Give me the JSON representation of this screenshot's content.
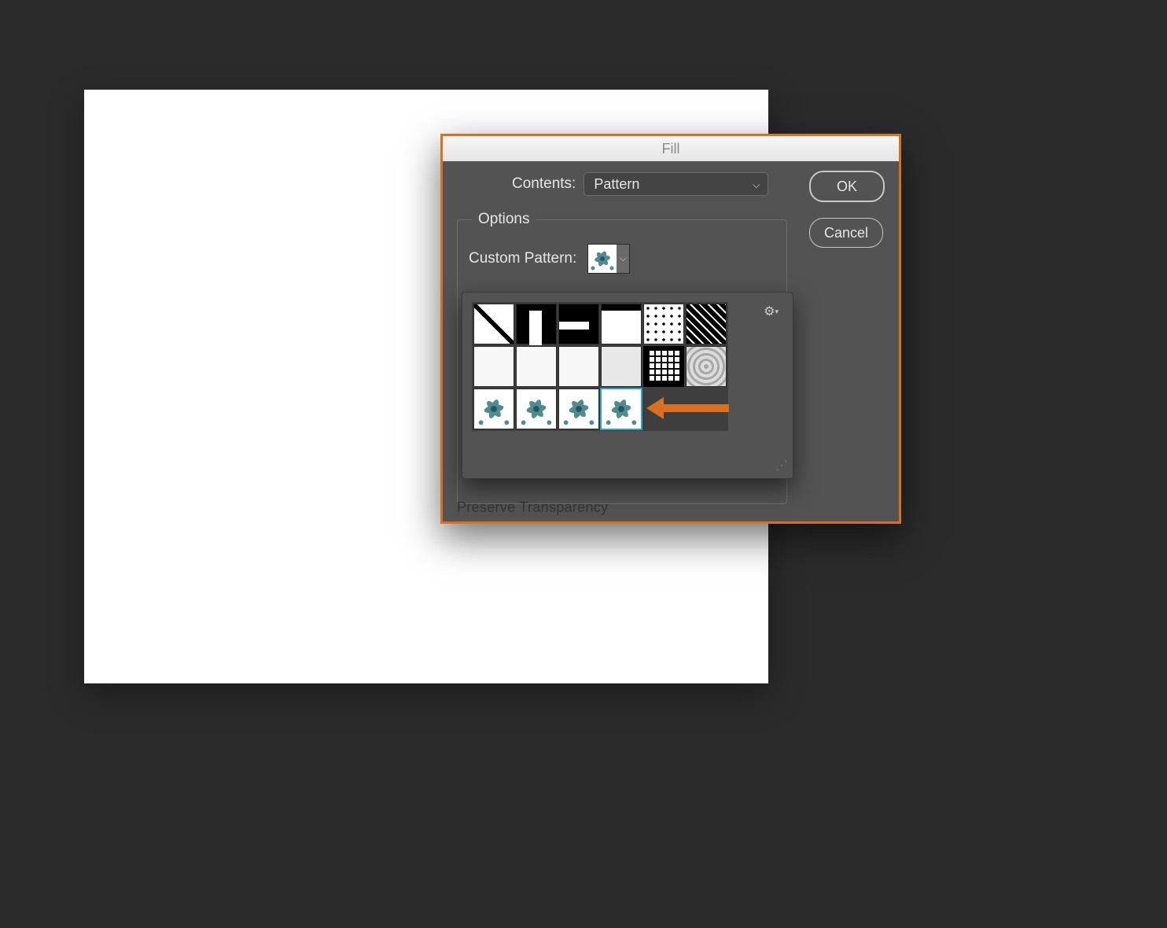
{
  "dialog": {
    "title": "Fill",
    "contents_label": "Contents:",
    "contents_value": "Pattern",
    "ok_label": "OK",
    "cancel_label": "Cancel",
    "options_label": "Options",
    "custom_pattern_label": "Custom Pattern:",
    "preserve_transparency_label": "Preserve Transparency"
  },
  "picker": {
    "gear_icon": "gear-icon",
    "selected_index": 15,
    "patterns": [
      {
        "name": "diagonal-line"
      },
      {
        "name": "vertical-bar"
      },
      {
        "name": "horizontal-bar"
      },
      {
        "name": "top-stripe"
      },
      {
        "name": "polka-dots"
      },
      {
        "name": "pixel-diagonal"
      },
      {
        "name": "noise-light-1"
      },
      {
        "name": "noise-light-2"
      },
      {
        "name": "noise-light-3"
      },
      {
        "name": "noise-gray"
      },
      {
        "name": "concentric-squares"
      },
      {
        "name": "gray-ripple"
      },
      {
        "name": "teal-flower-1"
      },
      {
        "name": "teal-flower-2"
      },
      {
        "name": "teal-flower-3"
      },
      {
        "name": "teal-flower-4"
      }
    ]
  },
  "annotation": {
    "arrow_color": "#d96f20"
  }
}
